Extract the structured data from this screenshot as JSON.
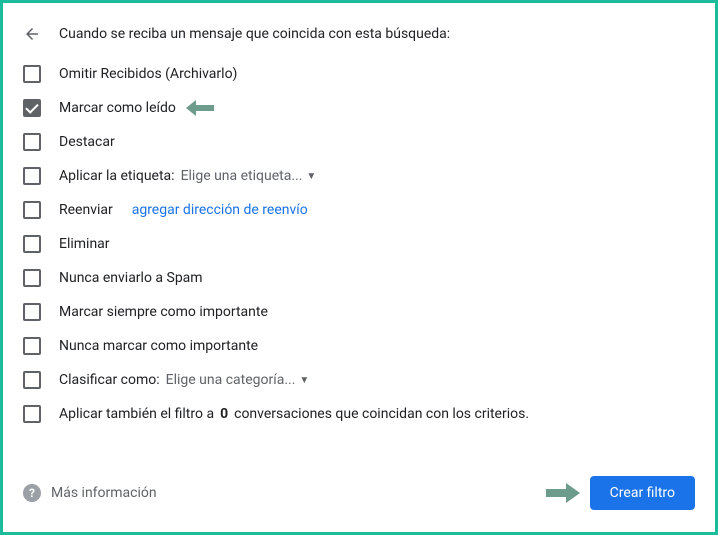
{
  "header": {
    "title": "Cuando se reciba un mensaje que coincida con esta búsqueda:"
  },
  "options": {
    "archive": "Omitir Recibidos (Archivarlo)",
    "markRead": "Marcar como leído",
    "star": "Destacar",
    "applyLabel": "Aplicar la etiqueta:",
    "applyLabelDropdown": "Elige una etiqueta...",
    "forward": "Reenviar",
    "forwardLink": "agregar dirección de reenvío",
    "delete": "Eliminar",
    "neverSpam": "Nunca enviarlo a Spam",
    "alwaysImportant": "Marcar siempre como importante",
    "neverImportant": "Nunca marcar como importante",
    "categorize": "Clasificar como:",
    "categorizeDropdown": "Elige una categoría...",
    "applyToPrefix": "Aplicar también el filtro a ",
    "applyToCount": "0",
    "applyToSuffix": " conversaciones que coincidan con los criterios."
  },
  "footer": {
    "moreInfo": "Más información",
    "createFilter": "Crear filtro"
  },
  "colors": {
    "annotationArrow": "#6d9b8c"
  }
}
